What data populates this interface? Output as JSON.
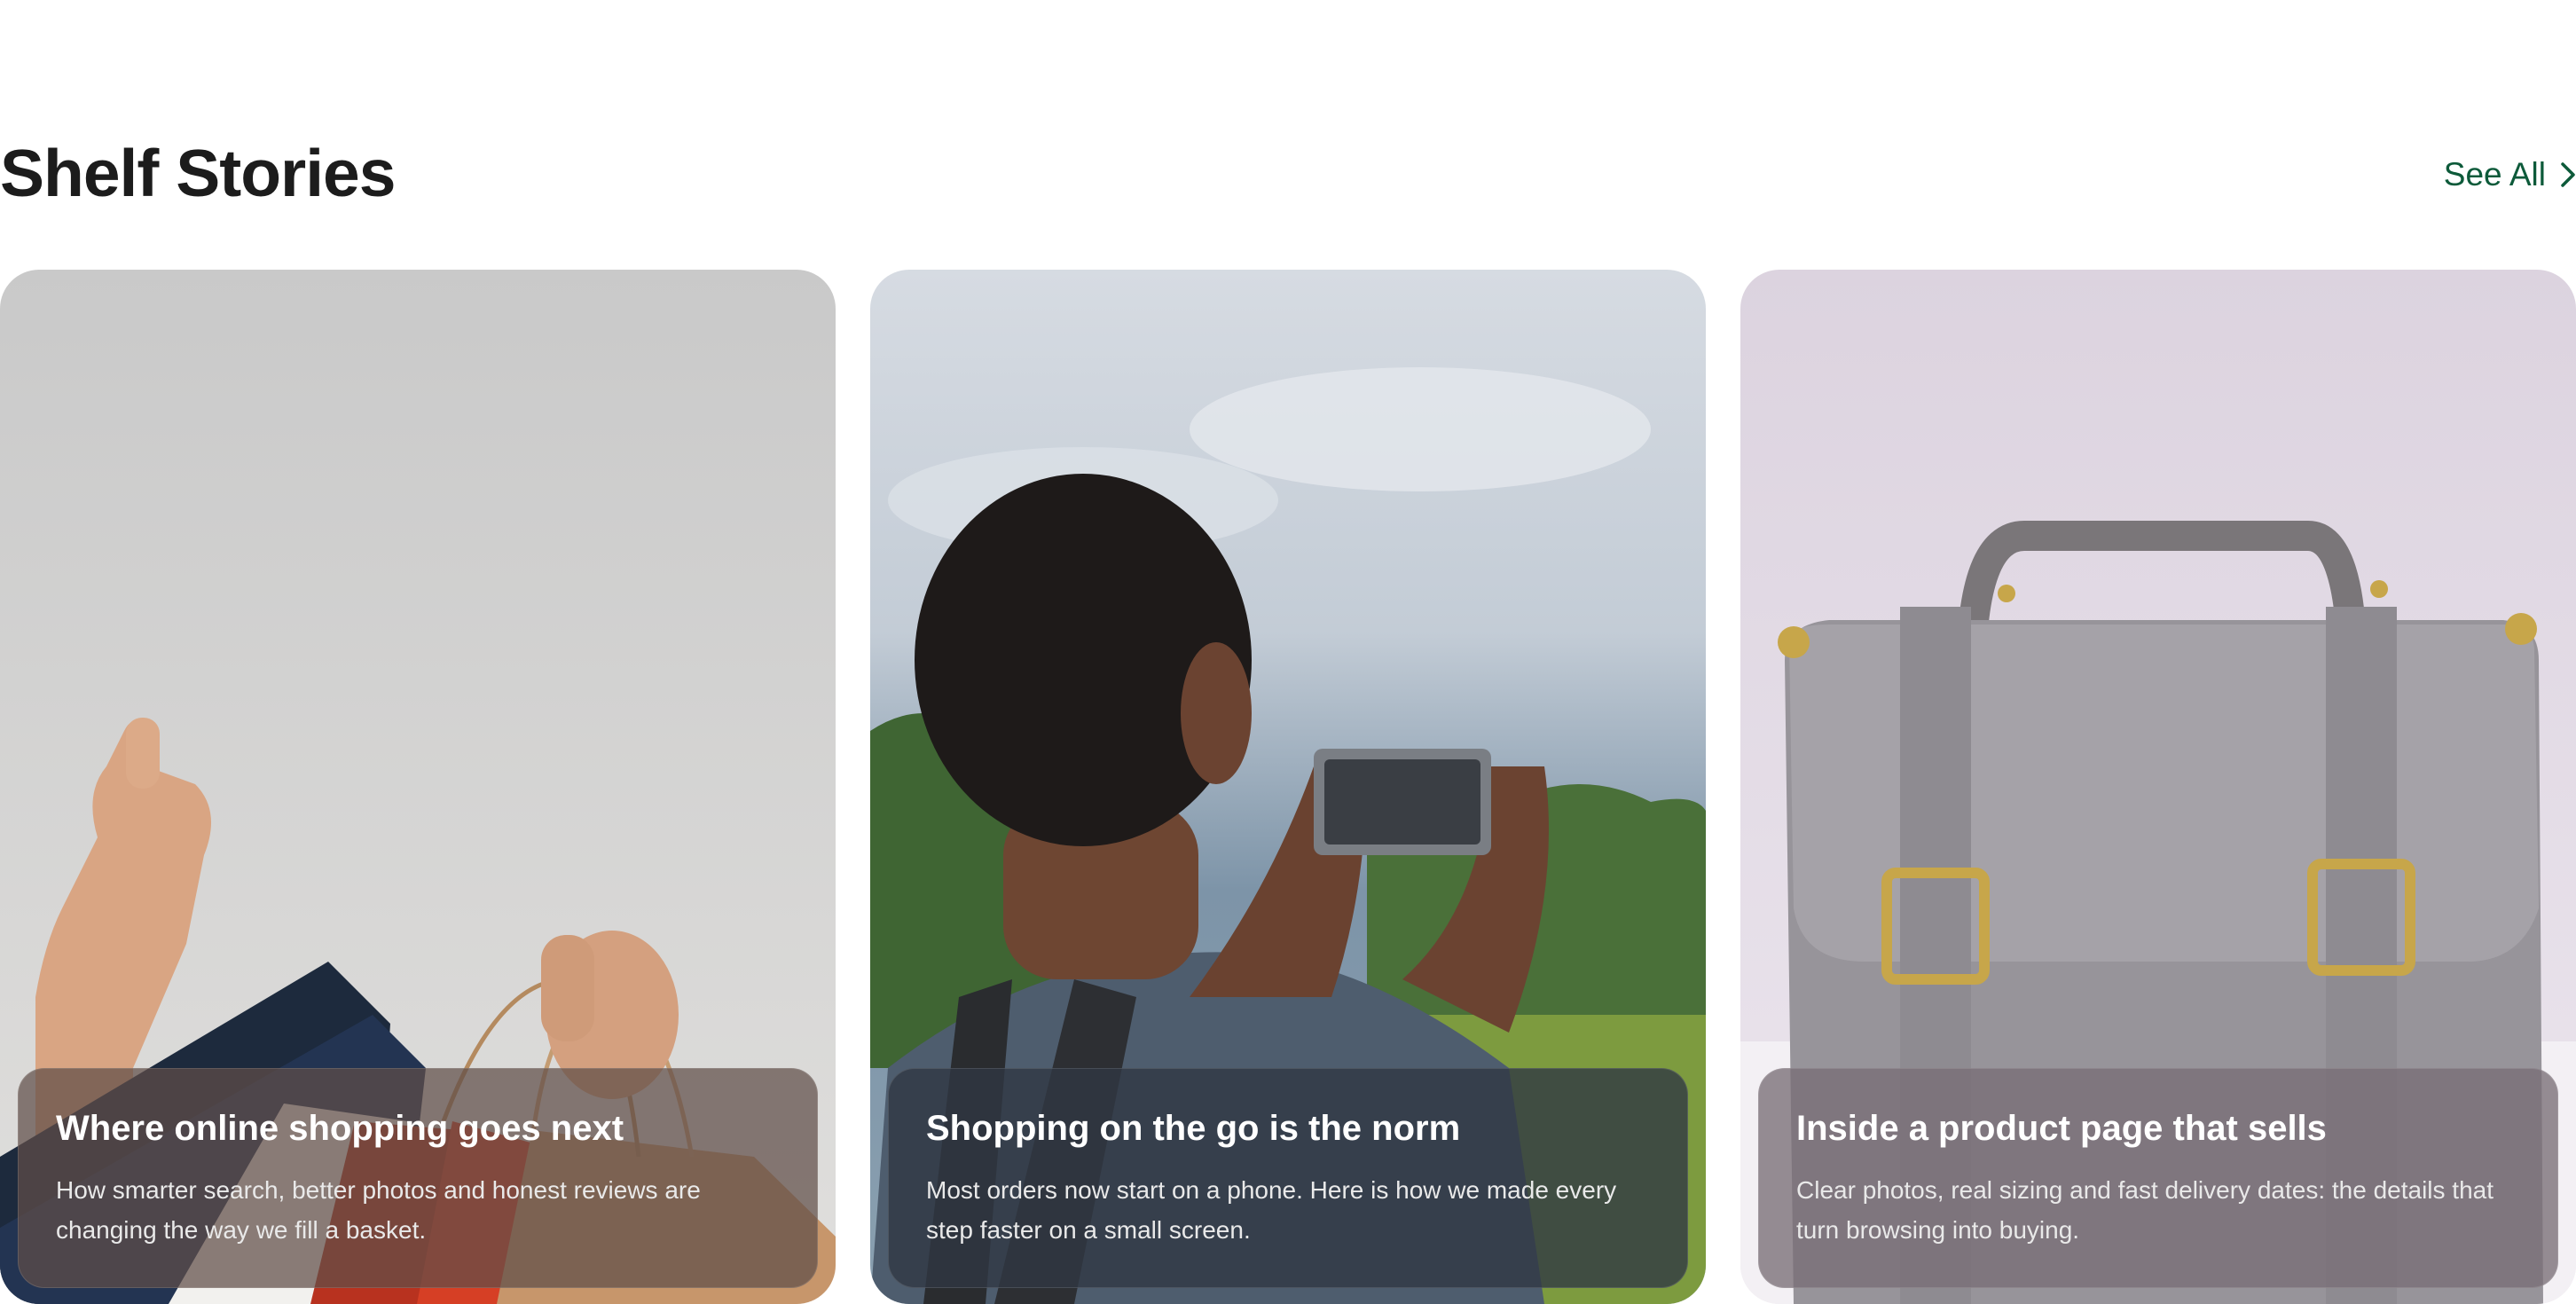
{
  "section": {
    "title": "Shelf Stories",
    "see_all_label": "See All",
    "accent_color": "#0d5a3a"
  },
  "cards": [
    {
      "title": "Where online shopping goes next",
      "description": "How smarter search, better photos and honest reviews are changing the way we fill a basket.",
      "image": "hand-holding-shopping-bags-photo"
    },
    {
      "title": "Shopping on the go is the norm",
      "description": "Most orders now start on a phone. Here is how we made every step faster on a small screen.",
      "image": "man-photographing-with-phone-photo"
    },
    {
      "title": "Inside a product page that sells",
      "description": "Clear photos, real sizing and fast delivery dates: the details that turn browsing into buying.",
      "image": "grey-leather-satchel-photo"
    }
  ]
}
